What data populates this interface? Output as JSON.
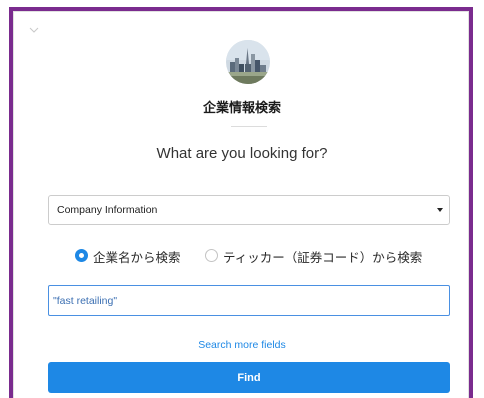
{
  "header": {
    "chevron_icon": "chevron-down-icon",
    "avatar_icon": "city-skyline-avatar",
    "title": "企業情報検索",
    "question": "What are you looking for?"
  },
  "search_type_select": {
    "selected": "Company Information",
    "arrow_icon": "caret-down-icon"
  },
  "search_mode": {
    "options": [
      {
        "label": "企業名から検索",
        "checked": true
      },
      {
        "label": "ティッカー（証券コード）から検索",
        "checked": false
      }
    ]
  },
  "query_input": {
    "value": "\"fast retailing\""
  },
  "more_fields_link": "Search more fields",
  "find_button": "Find",
  "colors": {
    "frame": "#7a2b8e",
    "accent": "#1e88e5",
    "input_border": "#4a90e2"
  }
}
